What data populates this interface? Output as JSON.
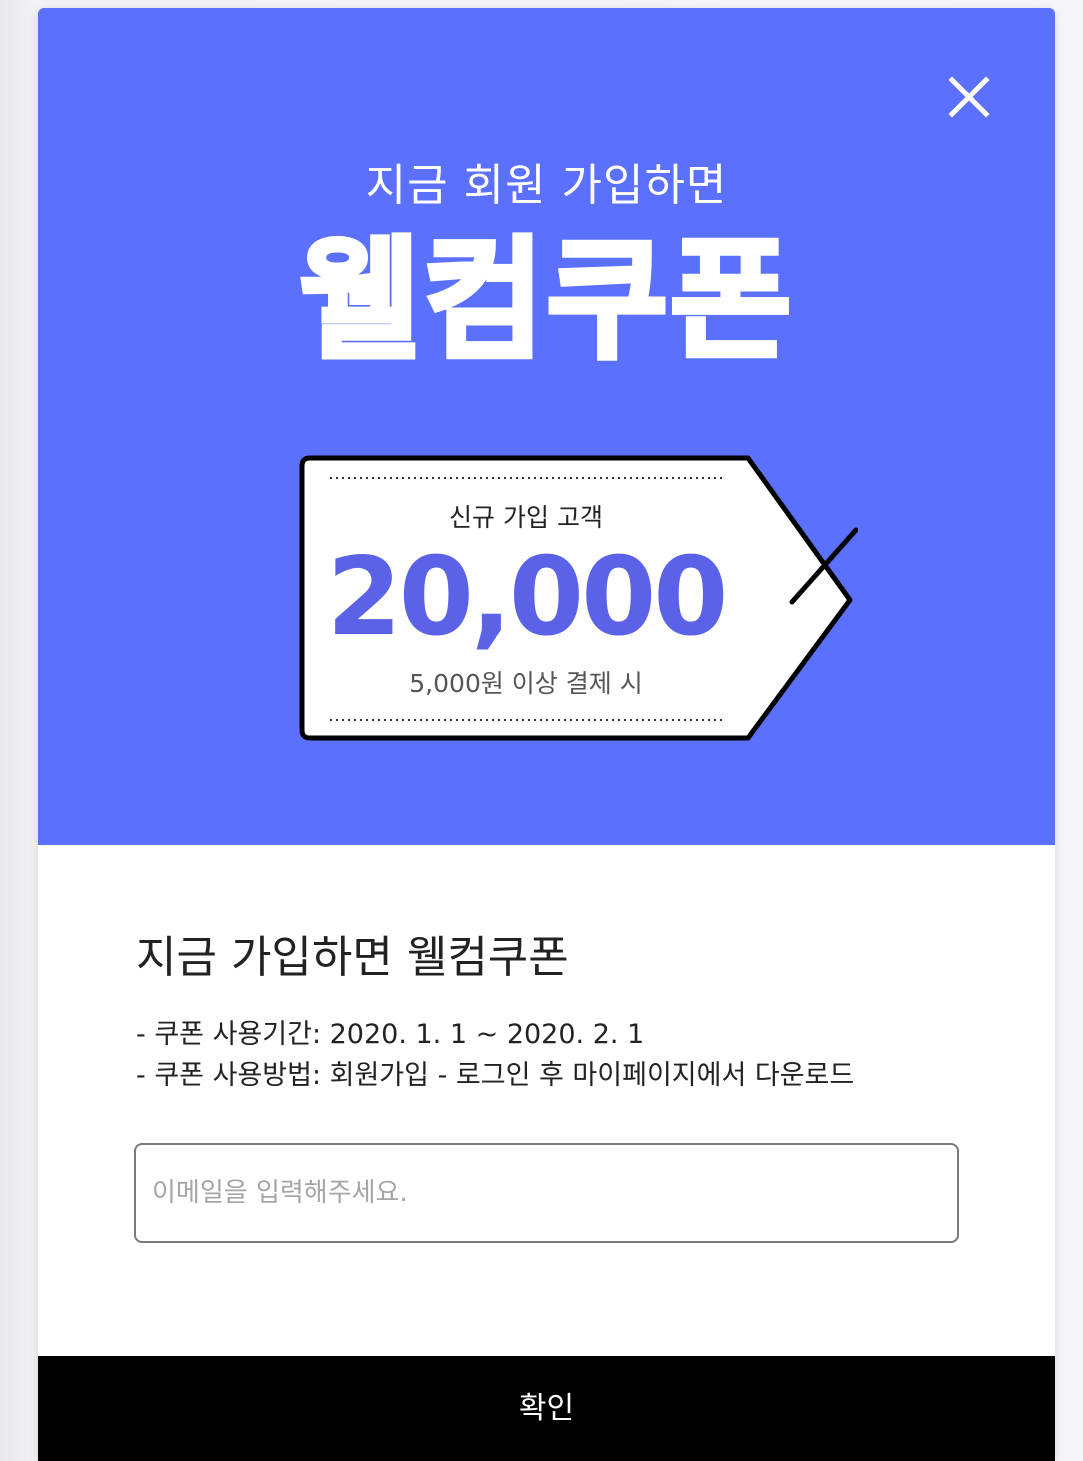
{
  "hero": {
    "subtitle": "지금 회원 가입하면",
    "title": "웰컴쿠폰",
    "background_color": "#5b70fd",
    "close_icon": "close-icon"
  },
  "coupon": {
    "label": "신규 가입 고객",
    "amount": "20,000",
    "condition": "5,000원 이상 결제 시",
    "amount_color": "#5b62e8"
  },
  "content": {
    "title": "지금 가입하면 웰컴쿠폰",
    "period": "- 쿠폰 사용기간: 2020. 1. 1 ~ 2020. 2. 1",
    "usage": "- 쿠폰 사용방법: 회원가입 - 로그인 후 마이페이지에서 다운로드"
  },
  "form": {
    "email_placeholder": "이메일을 입력해주세요.",
    "email_value": ""
  },
  "confirm_button": {
    "label": "확인",
    "color": "#000000"
  }
}
